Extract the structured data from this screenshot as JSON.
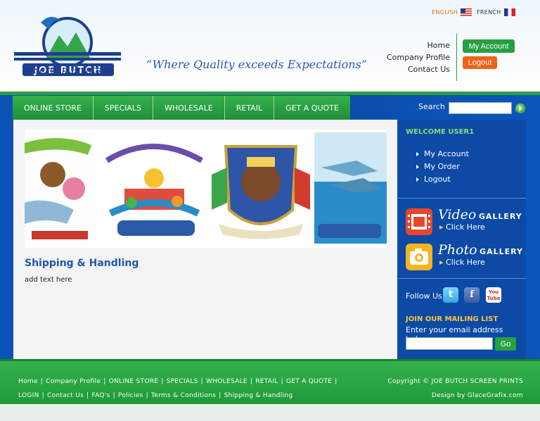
{
  "brand": {
    "logo_line1": "JOE BUTCH",
    "logo_line2": "Screen Prints",
    "tagline": "“Where Quality exceeds Expectations”"
  },
  "languages": [
    {
      "label": "ENGLISH",
      "flag": "us-flag"
    },
    {
      "label": "FRENCH",
      "flag": "fr-flag"
    }
  ],
  "top_links": [
    "Home",
    "Company Profile",
    "Contact Us"
  ],
  "account": {
    "my_account": "My Account",
    "logout": "Logout"
  },
  "nav": [
    "ONLINE STORE",
    "SPECIALS",
    "WHOLESALE",
    "RETAIL",
    "GET A QUOTE"
  ],
  "search": {
    "label": "Search"
  },
  "main": {
    "title": "Shipping & Handling",
    "body": "add text here"
  },
  "sidebar": {
    "welcome": "WELCOME USER1",
    "user_menu": [
      "My Account",
      "My Order",
      "Logout"
    ],
    "video": {
      "big": "Video",
      "small": "GALLERY",
      "click": "Click Here"
    },
    "photo": {
      "big": "Photo",
      "small": "GALLERY",
      "click": "Click Here"
    },
    "follow_label": "Follow Us",
    "social": {
      "twitter": "t",
      "facebook": "f",
      "youtube": "You Tube"
    },
    "mailing_title": "JOIN OUR MAILING LIST",
    "mailing_sub": "Enter your email address below",
    "mailing_go": "Go"
  },
  "footer": {
    "row1": [
      "Home",
      "Company Profile",
      "ONLINE STORE",
      "SPECIALS",
      "WHOLESALE",
      "RETAIL",
      "GET A QUOTE"
    ],
    "row2": [
      "LOGIN",
      "Contact Us",
      "FAQ's",
      "Policies",
      "Terms & Conditions",
      "Shipping & Handling"
    ],
    "copyright": "Copyright © JOE BUTCH SCREEN PRINTS",
    "design": "Design by GlaceGrafix.com"
  },
  "colors": {
    "brand_green": "#26a040",
    "brand_blue": "#0c4aa6",
    "logout_orange": "#f06217",
    "heading_blue": "#1f55b5"
  }
}
